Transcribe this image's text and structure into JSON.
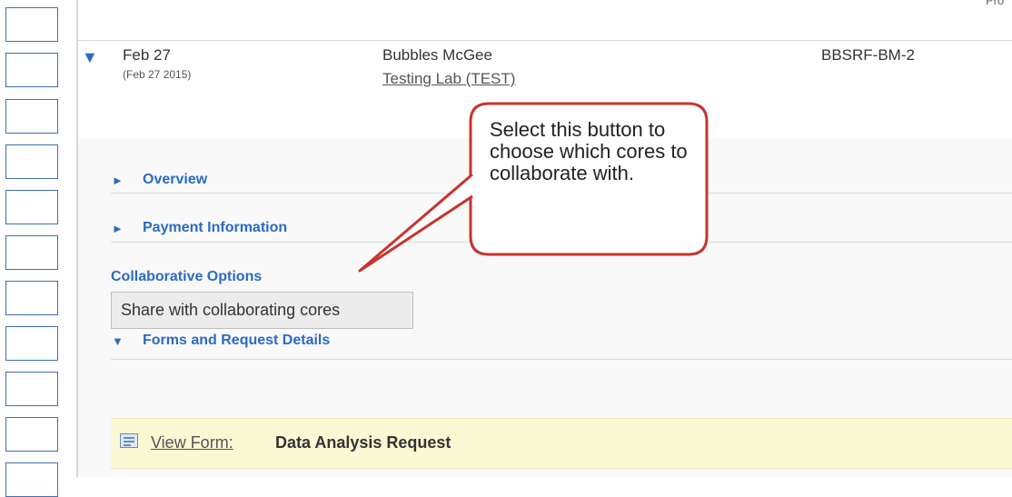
{
  "corner": {
    "text": "Pro"
  },
  "row": {
    "date": "Feb 27",
    "date_full": "(Feb 27 2015)",
    "name": "Bubbles McGee",
    "lab": "Testing Lab (TEST)",
    "code": "BBSRF-BM-2",
    "expand_icon": "triangle-down-icon"
  },
  "sections": {
    "overview": "Overview",
    "payment": "Payment Information",
    "collab_label": "Collaborative Options",
    "share_button": "Share with collaborating cores",
    "forms": "Forms and Request Details"
  },
  "form": {
    "icon": "form-icon",
    "link": "View Form:",
    "name": "Data Analysis Request"
  },
  "callout": {
    "text": "Select this button to choose which cores to collaborate with."
  },
  "colors": {
    "link_blue": "#2a6bc4",
    "callout_border": "#c0392b",
    "form_bar": "#fbf8d4"
  }
}
